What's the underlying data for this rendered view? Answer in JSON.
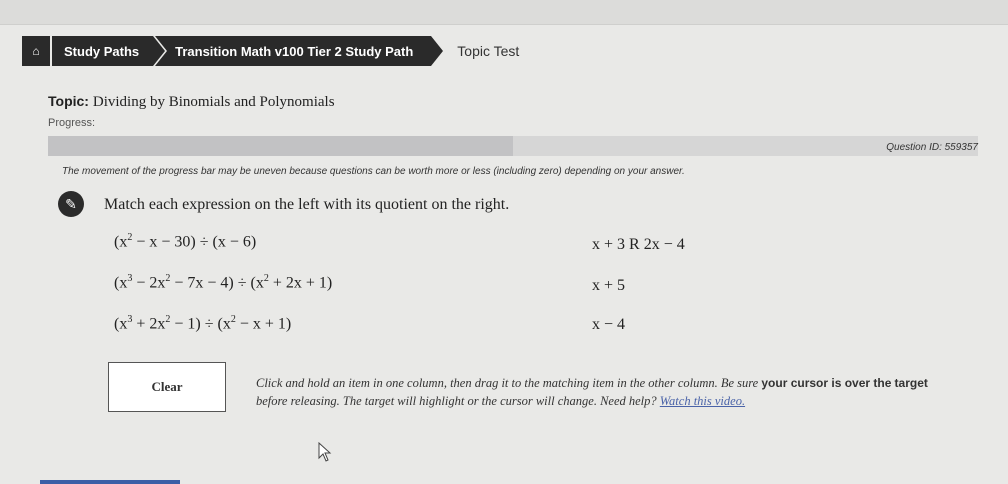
{
  "breadcrumb": {
    "home_icon": "home-icon",
    "items": [
      "Study Paths",
      "Transition Math v100 Tier 2 Study Path"
    ],
    "current": "Topic Test"
  },
  "topic": {
    "label": "Topic:",
    "value": "Dividing by Binomials and Polynomials"
  },
  "progress": {
    "label": "Progress:",
    "fraction": 0.5
  },
  "question_id": "Question ID: 559357",
  "note": "The movement of the progress bar may be uneven because questions can be worth more or less (including zero) depending on your answer.",
  "question": {
    "icon": "pencil-icon",
    "instruction": "Match each expression on the left with its quotient on the right.",
    "left": [
      {
        "parts": [
          "(x",
          "2",
          " − x − 30) ÷ (x − 6)"
        ]
      },
      {
        "parts": [
          "(x",
          "3",
          " − 2x",
          "2",
          " − 7x − 4) ÷ (x",
          "2",
          " + 2x + 1)"
        ]
      },
      {
        "parts": [
          "(x",
          "3",
          " + 2x",
          "2",
          " − 1) ÷ (x",
          "2",
          " − x + 1)"
        ]
      }
    ],
    "right": [
      "x + 3 R 2x − 4",
      "x + 5",
      "x − 4"
    ]
  },
  "clear_label": "Clear",
  "help": {
    "text1": "Click and hold an item in one column, then drag it to the matching item in the other column. Be sure ",
    "bold1": "your cursor is over the",
    "bold2": "target",
    "text2": " before releasing. The target will highlight or the cursor will change. Need help? ",
    "link": "Watch this video."
  }
}
